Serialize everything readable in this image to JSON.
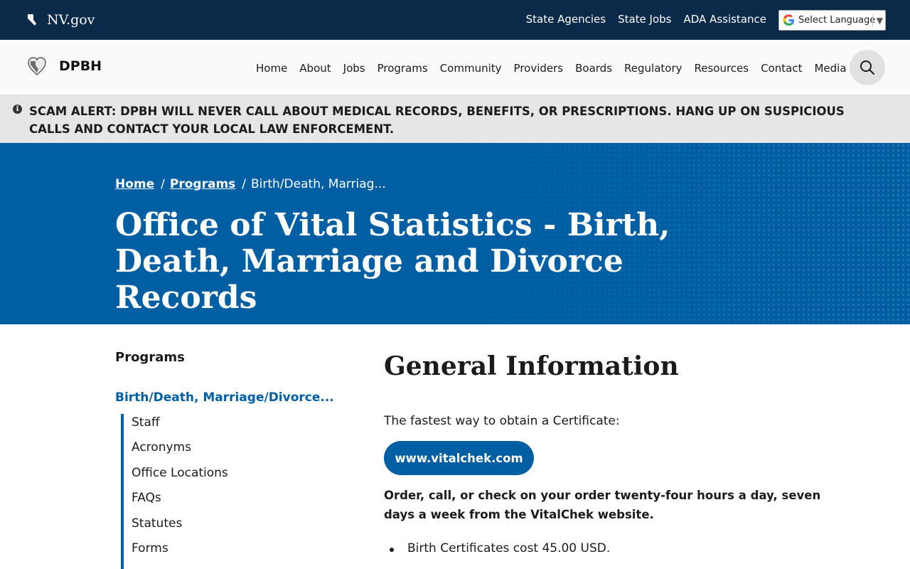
{
  "govbar": {
    "site": "NV.gov",
    "links": [
      "State Agencies",
      "State Jobs",
      "ADA Assistance"
    ],
    "language_select": "Select Language"
  },
  "header": {
    "brand": "DPBH",
    "nav": [
      "Home",
      "About",
      "Jobs",
      "Programs",
      "Community",
      "Providers",
      "Boards",
      "Regulatory",
      "Resources",
      "Contact",
      "Media"
    ]
  },
  "alert": {
    "text": "SCAM ALERT: DPBH WILL NEVER CALL ABOUT MEDICAL RECORDS, BENEFITS, OR PRESCRIPTIONS. HANG UP ON SUSPICIOUS CALLS AND CONTACT YOUR LOCAL LAW ENFORCEMENT."
  },
  "hero": {
    "breadcrumb": [
      "Home",
      "Programs",
      "Birth/Death, Marriag..."
    ],
    "title": "Office of Vital Statistics - Birth, Death, Marriage and Divorce Records"
  },
  "sidebar": {
    "title": "Programs",
    "current": "Birth/Death, Marriage/Divorce...",
    "items": [
      "Staff",
      "Acronyms",
      "Office Locations",
      "FAQs",
      "Statutes",
      "Forms"
    ]
  },
  "content": {
    "title": "General Information",
    "lead": "The fastest way to obtain a Certificate:",
    "cta": "www.vitalchek.com",
    "note": "Order, call, or check on your order twenty-four hours a day, seven days a week from the VitalChek website.",
    "fees": [
      "Birth Certificates cost 45.00 USD."
    ]
  },
  "colors": {
    "govbar": "#0b2a4a",
    "primary": "#005ea2",
    "alert_bg": "#e6e6e6"
  },
  "icons": [
    "nevada-state-icon",
    "google-icon",
    "heart-logo-icon",
    "search-icon",
    "info-icon"
  ]
}
